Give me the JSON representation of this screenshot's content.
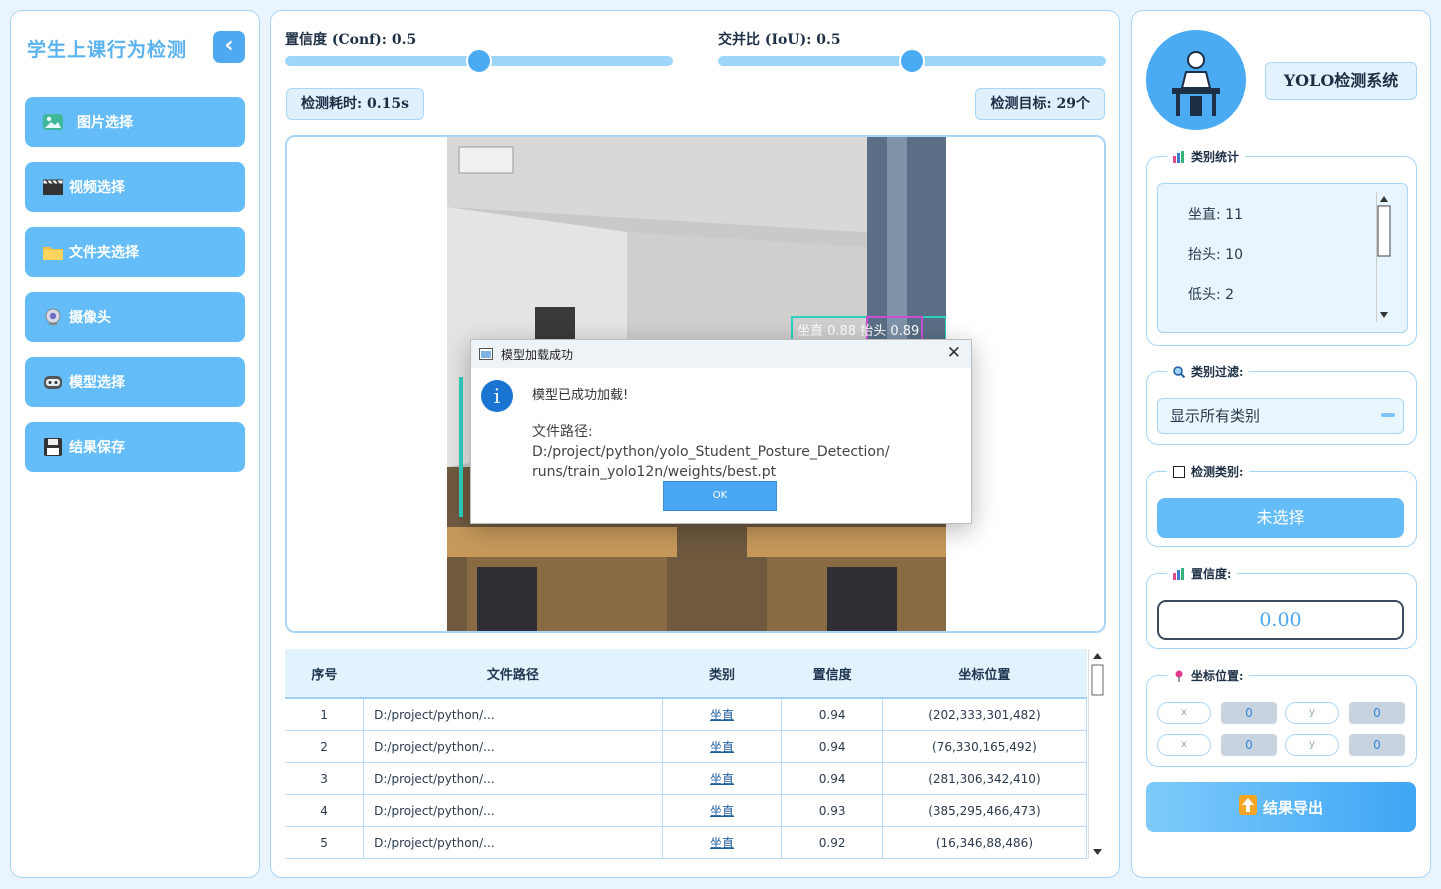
{
  "sidebar": {
    "title": "学生上课行为检测",
    "collapse_glyph": "‹",
    "buttons": [
      {
        "label": "图片选择",
        "icon": "image-icon"
      },
      {
        "label": "视频选择",
        "icon": "video-clapper-icon"
      },
      {
        "label": "文件夹选择",
        "icon": "folder-icon"
      },
      {
        "label": "摄像头",
        "icon": "webcam-icon"
      },
      {
        "label": "模型选择",
        "icon": "robot-icon"
      },
      {
        "label": "结果保存",
        "icon": "floppy-disk-icon"
      }
    ]
  },
  "sliders": {
    "conf": {
      "label": "置信度 (Conf): 0.5",
      "value": 0.5
    },
    "iou": {
      "label": "交并比 (IoU): 0.5",
      "value": 0.5
    }
  },
  "stats": {
    "time": "检测耗时: 0.15s",
    "targets": "检测目标: 29个"
  },
  "photo_overlay_text": "坐直 0.88 抬头 0.89",
  "table": {
    "headers": [
      "序号",
      "文件路径",
      "类别",
      "置信度",
      "坐标位置"
    ],
    "rows": [
      [
        "1",
        "D:/project/python/...",
        "坐直",
        "0.94",
        "(202,333,301,482)"
      ],
      [
        "2",
        "D:/project/python/...",
        "坐直",
        "0.94",
        "(76,330,165,492)"
      ],
      [
        "3",
        "D:/project/python/...",
        "坐直",
        "0.94",
        "(281,306,342,410)"
      ],
      [
        "4",
        "D:/project/python/...",
        "坐直",
        "0.93",
        "(385,295,466,473)"
      ],
      [
        "5",
        "D:/project/python/...",
        "坐直",
        "0.92",
        "(16,346,88,486)"
      ]
    ]
  },
  "dialog": {
    "title": "模型加载成功",
    "info_glyph": "i",
    "message": "模型已成功加载!",
    "path_line1": "文件路径: D:/project/python/yolo_Student_Posture_Detection/",
    "path_line2": "runs/train_yolo12n/weights/best.pt",
    "ok_label": "OK"
  },
  "right": {
    "system_title": "YOLO检测系统",
    "category_stats_legend": "类别统计",
    "category_stats": [
      "坐直: 11",
      "抬头: 10",
      "低头: 2"
    ],
    "filter_legend": "类别过滤:",
    "filter_value": "显示所有类别",
    "detect_class_legend": "检测类别:",
    "detect_class_value": "未选择",
    "confidence_legend": "置信度:",
    "confidence_value": "0.00",
    "coords_legend": "坐标位置:",
    "coords": [
      {
        "label": "x",
        "value": "0"
      },
      {
        "label": "y",
        "value": "0"
      },
      {
        "label": "x",
        "value": "0"
      },
      {
        "label": "y",
        "value": "0"
      }
    ],
    "export_label": "结果导出"
  },
  "colors": {
    "accent": "#64bdf8",
    "accent_dark": "#4aa7f2",
    "panel_border": "#a9d6f7",
    "background": "#e9f4fd"
  }
}
